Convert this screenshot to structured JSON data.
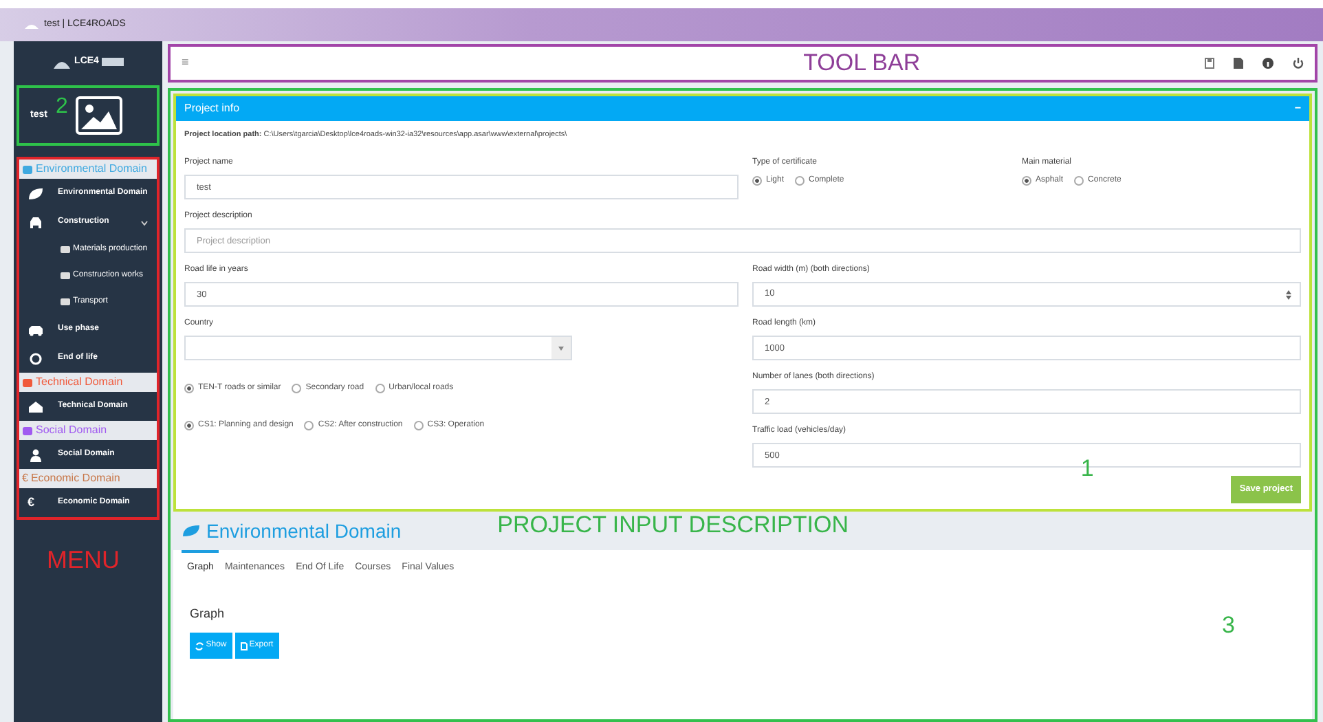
{
  "window": {
    "title": "test | LCE4ROADS"
  },
  "sidebar": {
    "logo": "LCE4",
    "user": "test",
    "user_annotation": "2",
    "menu_annotation": "MENU",
    "menu": [
      {
        "kind": "header",
        "label": "Environmental Domain",
        "color": "#3fa9e0"
      },
      {
        "kind": "item",
        "label": "Environmental Domain"
      },
      {
        "kind": "item",
        "label": "Construction",
        "expanded": true,
        "children": [
          {
            "label": "Materials production"
          },
          {
            "label": "Construction works"
          },
          {
            "label": "Transport"
          }
        ]
      },
      {
        "kind": "item",
        "label": "Use phase"
      },
      {
        "kind": "item",
        "label": "End of life"
      },
      {
        "kind": "header",
        "label": "Technical Domain",
        "color": "#f05a3c"
      },
      {
        "kind": "item",
        "label": "Technical Domain"
      },
      {
        "kind": "header",
        "label": "Social Domain",
        "color": "#a05af0"
      },
      {
        "kind": "item",
        "label": "Social Domain"
      },
      {
        "kind": "header",
        "label": "Economic Domain",
        "color": "#c8784a",
        "icon": "€"
      },
      {
        "kind": "item",
        "label": "Economic Domain",
        "icon": "€"
      }
    ]
  },
  "toolbar": {
    "menu_glyph": "≡",
    "annotation": "TOOL BAR"
  },
  "project": {
    "title": "Project info",
    "collapse": "−",
    "path": "**Project location path:** C:\\Users\\tgarcia\\Desktop\\lce4roads-win32-ia32\\resources\\app.asar\\www\\external\\projects\\",
    "name": {
      "label": "Project name",
      "value": "test"
    },
    "certificate": {
      "label": "Type of certificate",
      "options": [
        {
          "label": "Light",
          "selected": true
        },
        {
          "label": "Complete",
          "selected": false
        }
      ]
    },
    "material": {
      "label": "Main material",
      "options": [
        {
          "label": "Asphalt",
          "selected": true
        },
        {
          "label": "Concrete",
          "selected": false
        }
      ]
    },
    "description": {
      "label": "Project description",
      "placeholder": "Project description"
    },
    "road_life": {
      "label": "Road life in years",
      "value": "30"
    },
    "road_width": {
      "label": "Road width (m) (both directions)",
      "value": "10"
    },
    "country": {
      "label": "Country"
    },
    "road_length": {
      "label": "Road length (km)",
      "value": "1000"
    },
    "road_type": [
      {
        "label": "TEN-T roads or similar",
        "selected": true
      },
      {
        "label": "Secondary road",
        "selected": false
      },
      {
        "label": "Urban/local roads",
        "selected": false
      }
    ],
    "stage": [
      {
        "label": "CS1: Planning and design",
        "selected": true
      },
      {
        "label": "CS2: After construction",
        "selected": false
      },
      {
        "label": "CS3: Operation",
        "selected": false
      }
    ],
    "lanes": {
      "label": "Number of lanes (both directions)",
      "value": "2"
    },
    "traffic": {
      "label": "Traffic load (vehicles/day)",
      "value": "500"
    },
    "annotation": "1",
    "save": "Save project"
  },
  "section_annotation": "PROJECT INPUT DESCRIPTION",
  "domain": {
    "title": "Environmental Domain",
    "tabs": [
      {
        "label": "Graph",
        "selected": true
      },
      {
        "label": "Maintenances",
        "selected": false
      },
      {
        "label": "End Of Life",
        "selected": false
      },
      {
        "label": "Courses",
        "selected": false
      },
      {
        "label": "Final Values",
        "selected": false
      }
    ],
    "heading": "Graph",
    "buttons": [
      "Show",
      "Export"
    ],
    "annotation": "3"
  }
}
